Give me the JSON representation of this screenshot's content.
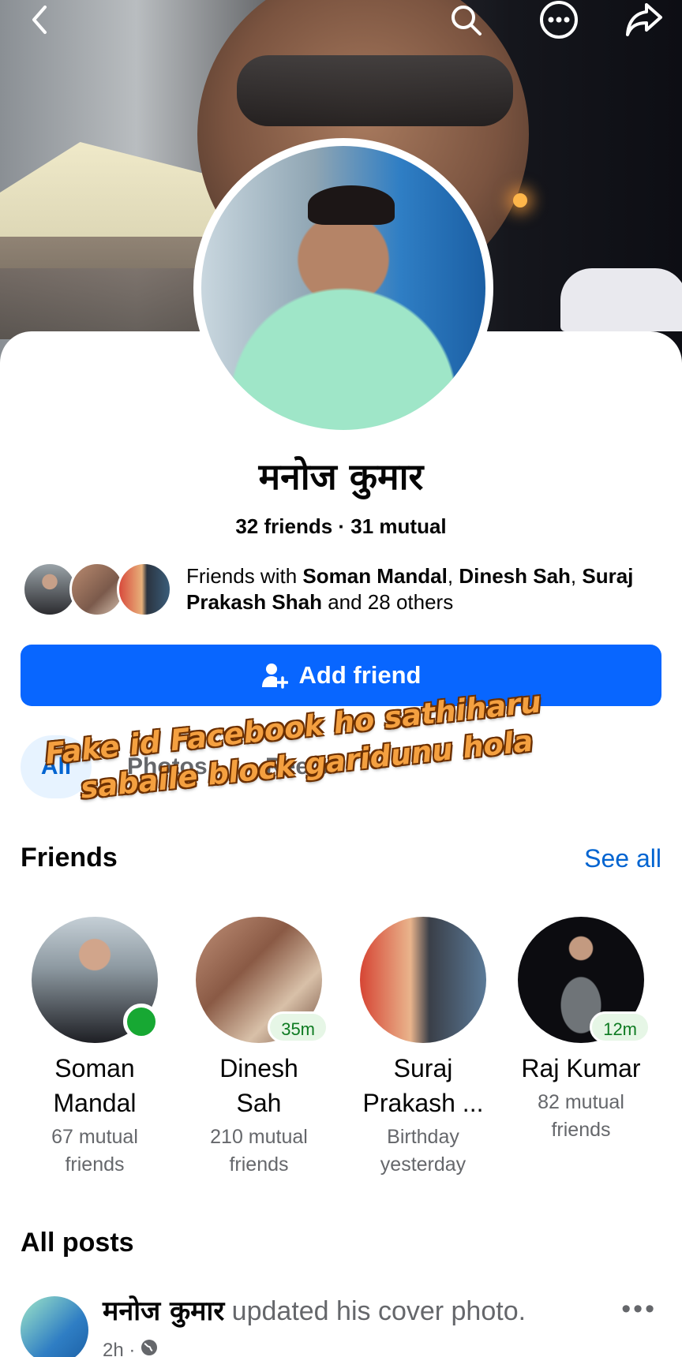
{
  "profile": {
    "name": "मनोज कुमार",
    "counts": "32 friends · 31 mutual",
    "mutual_prefix": "Friends with ",
    "mutual_names_1": "Soman Mandal",
    "mutual_sep_1": ", ",
    "mutual_names_2": "Dinesh Sah",
    "mutual_sep_2": ", ",
    "mutual_names_3": "Suraj Prakash Shah",
    "mutual_suffix": " and 28 others",
    "add_friend_label": "Add friend"
  },
  "tabs": [
    {
      "label": "All",
      "active": true
    },
    {
      "label": "Photos",
      "active": false
    },
    {
      "label": "Reels",
      "active": false
    }
  ],
  "overlay": {
    "line1": "Fake id Facebook ho sathiharu",
    "line2": "sabaile block garidunu hola"
  },
  "friends_section": {
    "title": "Friends",
    "see_all": "See all",
    "items": [
      {
        "name_1": "Soman",
        "name_2": "Mandal",
        "sub_1": "67 mutual",
        "sub_2": "friends",
        "badge": ""
      },
      {
        "name_1": "Dinesh",
        "name_2": "Sah",
        "sub_1": "210 mutual",
        "sub_2": "friends",
        "badge": "35m"
      },
      {
        "name_1": "Suraj",
        "name_2": "Prakash ...",
        "sub_1": "Birthday",
        "sub_2": "yesterday",
        "badge": ""
      },
      {
        "name_1": "Raj Kumar",
        "name_2": "",
        "sub_1": "82 mutual",
        "sub_2": "friends",
        "badge": "12m"
      }
    ]
  },
  "posts": {
    "title": "All posts",
    "first": {
      "author": "मनोज कुमार",
      "action": " updated his cover photo.",
      "time": "2h ·",
      "more": "•••"
    }
  },
  "icons": [
    "back-icon",
    "search-icon",
    "more-icon",
    "share-icon",
    "add-friend-icon",
    "globe-icon"
  ],
  "colors": {
    "accent": "#0866ff",
    "link": "#0064d1",
    "online": "#17a833",
    "overlay_text": "#f4a040"
  }
}
